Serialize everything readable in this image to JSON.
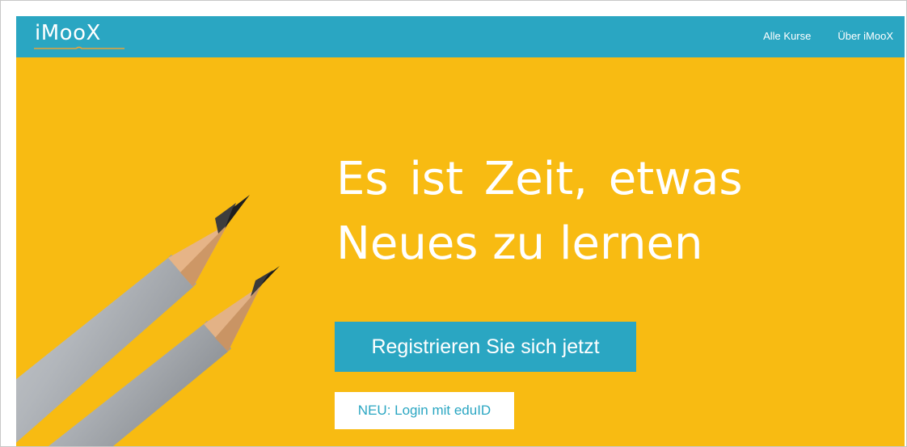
{
  "header": {
    "logo_text": "iMooX",
    "nav": [
      {
        "label": "Alle Kurse"
      },
      {
        "label": "Über iMooX"
      }
    ]
  },
  "hero": {
    "headline_line1": "Es ist Zeit, etwas",
    "headline_line2": "Neues zu lernen",
    "register_label": "Registrieren Sie sich jetzt",
    "eduid_label": "NEU: Login mit eduID",
    "image": "two-pencils"
  },
  "colors": {
    "brand": "#2aa6c2",
    "hero_background": "#f8bb12",
    "text_on_brand": "#ffffff",
    "logo_accent": "#e8a33a"
  }
}
